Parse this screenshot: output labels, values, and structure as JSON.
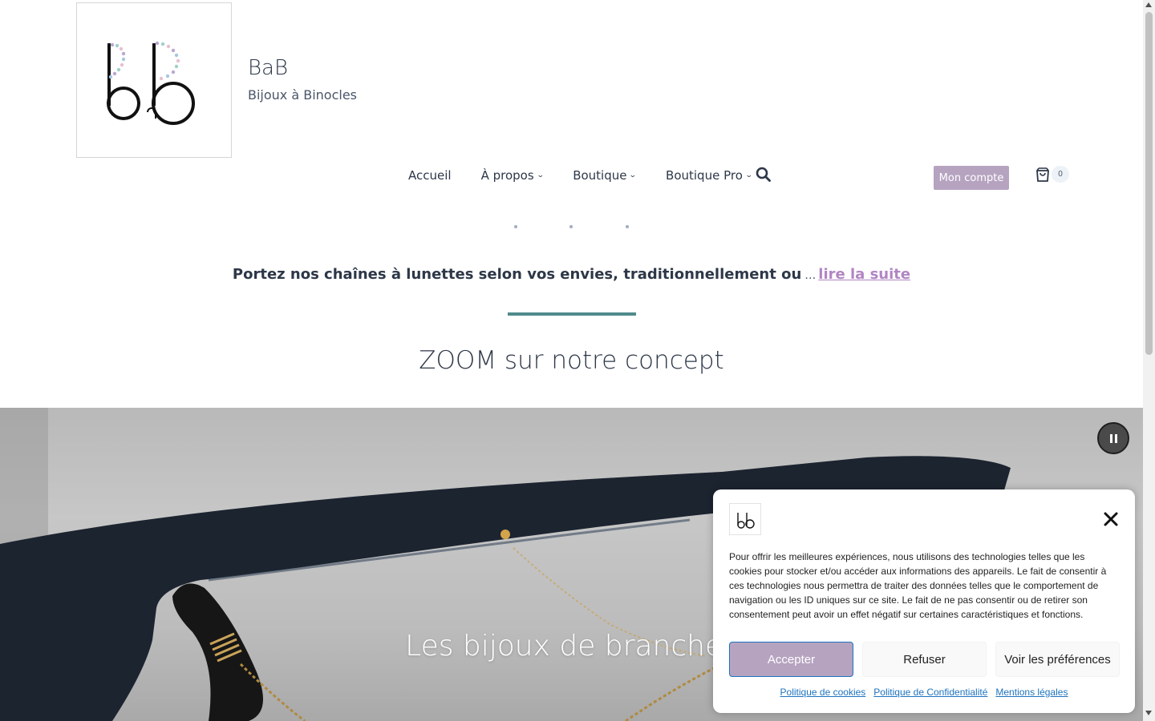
{
  "site": {
    "title": "BaB",
    "tagline": "Bijoux à Binocles"
  },
  "nav": {
    "items": [
      {
        "label": "Accueil",
        "has_dropdown": false
      },
      {
        "label": "À propos",
        "has_dropdown": true
      },
      {
        "label": "Boutique",
        "has_dropdown": true
      },
      {
        "label": "Boutique Pro",
        "has_dropdown": true
      }
    ],
    "search_icon": "search-icon",
    "account_label": "Mon compte",
    "cart_count": "0",
    "cart_icon": "shopping-bag-icon",
    "accent_color": "#b6a3c0"
  },
  "intro": {
    "text": "Portez nos chaînes à lunettes selon vos envies, traditionnellement ou",
    "ellipsis": "…",
    "read_more": "lire la suite"
  },
  "section": {
    "title": "ZOOM sur notre concept",
    "divider_color": "#4f8a8b"
  },
  "hero": {
    "caption": "Les bijoux de branches"
  },
  "cookie": {
    "text": "Pour offrir les meilleures expériences, nous utilisons des technologies telles que les cookies pour stocker et/ou accéder aux informations des appareils. Le fait de consentir à ces technologies nous permettra de traiter des données telles que le comportement de navigation ou les ID uniques sur ce site. Le fait de ne pas consentir ou de retirer son consentement peut avoir un effet négatif sur certaines caractéristiques et fonctions.",
    "accept": "Accepter",
    "deny": "Refuser",
    "preferences": "Voir les préférences",
    "links": [
      "Politique de cookies",
      "Politique de Confidentialité",
      "Mentions légales"
    ],
    "link_color": "#1e73be"
  }
}
